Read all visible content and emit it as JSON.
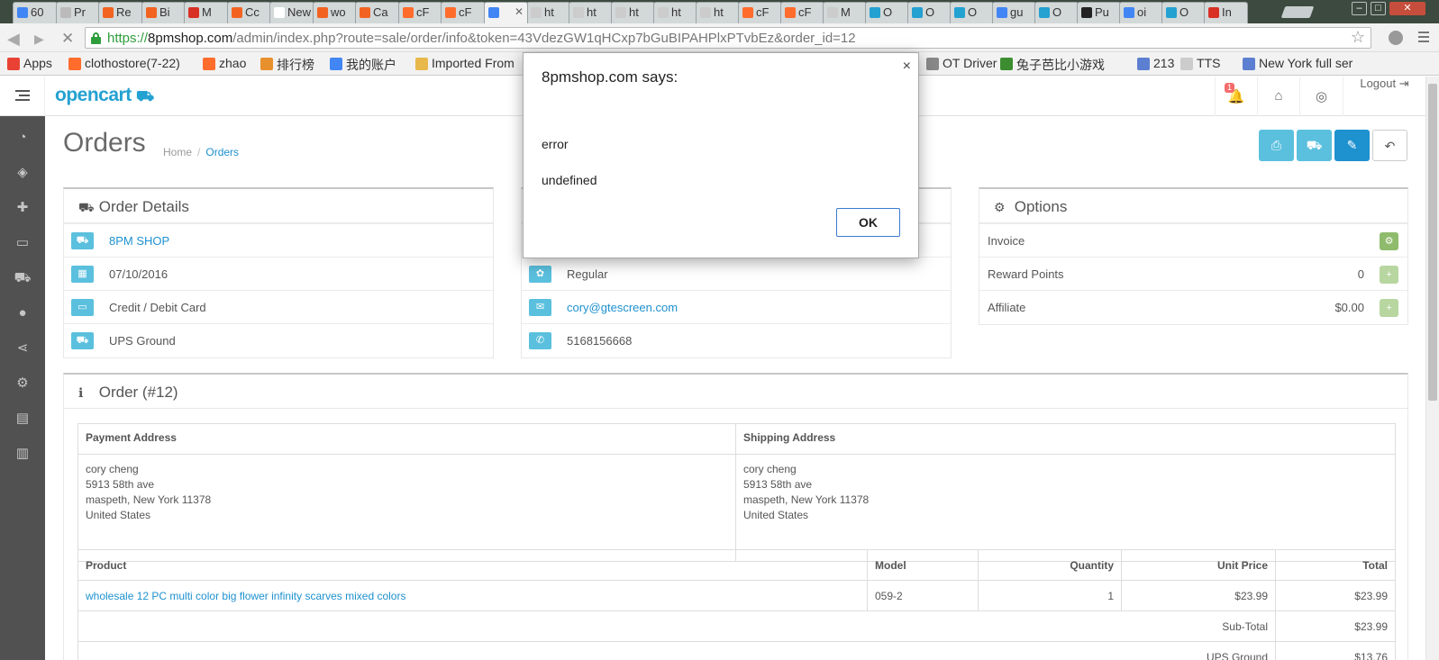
{
  "browser": {
    "tabs": [
      {
        "label": "60",
        "fav": "#4285f4"
      },
      {
        "label": "Pr",
        "fav": "#bbbbbb"
      },
      {
        "label": "Re",
        "fav": "#f26322"
      },
      {
        "label": "Bi",
        "fav": "#f26322"
      },
      {
        "label": "M",
        "fav": "#d93025"
      },
      {
        "label": "Cc",
        "fav": "#f26322"
      },
      {
        "label": "New",
        "fav": "#ffffff"
      },
      {
        "label": "wo",
        "fav": "#f26322"
      },
      {
        "label": "Ca",
        "fav": "#f26322"
      },
      {
        "label": "cF",
        "fav": "#ff6c2c"
      },
      {
        "label": "cF",
        "fav": "#ff6c2c"
      },
      {
        "label": "",
        "fav": "#4285f4"
      },
      {
        "label": "ht",
        "fav": "#cccccc"
      },
      {
        "label": "ht",
        "fav": "#cccccc"
      },
      {
        "label": "ht",
        "fav": "#cccccc"
      },
      {
        "label": "ht",
        "fav": "#cccccc"
      },
      {
        "label": "ht",
        "fav": "#cccccc"
      },
      {
        "label": "cF",
        "fav": "#ff6c2c"
      },
      {
        "label": "cF",
        "fav": "#ff6c2c"
      },
      {
        "label": "M",
        "fav": "#cccccc"
      },
      {
        "label": "O",
        "fav": "#23a1d1"
      },
      {
        "label": "O",
        "fav": "#23a1d1"
      },
      {
        "label": "O",
        "fav": "#23a1d1"
      },
      {
        "label": "gu",
        "fav": "#4285f4"
      },
      {
        "label": "O",
        "fav": "#23a1d1"
      },
      {
        "label": "Pu",
        "fav": "#222222"
      },
      {
        "label": "oi",
        "fav": "#4285f4"
      },
      {
        "label": "O",
        "fav": "#23a1d1"
      },
      {
        "label": "In",
        "fav": "#d93025"
      }
    ],
    "url": {
      "scheme": "https://",
      "host": "8pmshop.com",
      "path": "/admin/index.php?route=sale/order/info&token=43VdezGW1qHCxp7bGuBIPAHPlxPTvbEz&order_id=12"
    },
    "bookmarks": [
      {
        "label": "Apps",
        "color": "#e94235"
      },
      {
        "label": "clothostore(7-22)",
        "color": "#ff6c2c"
      },
      {
        "label": "zhao",
        "color": "#ff6c2c"
      },
      {
        "label": "排行榜",
        "color": "#e8902d"
      },
      {
        "label": "我的账户",
        "color": "#4285f4"
      },
      {
        "label": "Imported From",
        "color": "#e8b84a"
      },
      {
        "label": "OT Driver",
        "color": "#888888"
      },
      {
        "label": "兔子芭比小游戏",
        "color": "#3c8d2f"
      },
      {
        "label": "213",
        "color": "#5c7fd1"
      },
      {
        "label": "TTS",
        "color": "#cccccc"
      },
      {
        "label": "New York full ser",
        "color": "#5c7fd1"
      }
    ]
  },
  "header": {
    "logo": "opencart",
    "notifications_count": "1",
    "logout_label": "Logout"
  },
  "page": {
    "title": "Orders",
    "breadcrumb_home": "Home",
    "breadcrumb_current": "Orders"
  },
  "order_details": {
    "title": "Order Details",
    "store": "8PM SHOP",
    "date": "07/10/2016",
    "payment_method": "Credit / Debit Card",
    "shipping_method": "UPS Ground"
  },
  "customer": {
    "group": "Regular",
    "email": "cory@gtescreen.com",
    "phone": "5168156668"
  },
  "options": {
    "title": "Options",
    "invoice_label": "Invoice",
    "reward_label": "Reward Points",
    "reward_value": "0",
    "affiliate_label": "Affiliate",
    "affiliate_value": "$0.00"
  },
  "order": {
    "title": "Order (#12)",
    "payment_address_header": "Payment Address",
    "shipping_address_header": "Shipping Address",
    "payment_address": [
      "cory cheng",
      "5913 58th ave",
      "maspeth, New York 11378",
      "United States"
    ],
    "shipping_address": [
      "cory cheng",
      "5913 58th ave",
      "maspeth, New York 11378",
      "United States"
    ],
    "columns": [
      "Product",
      "Model",
      "Quantity",
      "Unit Price",
      "Total"
    ],
    "product": {
      "name": "wholesale 12 PC multi color big flower infinity scarves mixed colors",
      "model": "059-2",
      "quantity": "1",
      "unit_price": "$23.99",
      "total": "$23.99"
    },
    "subtotal_label": "Sub-Total",
    "subtotal_value": "$23.99",
    "shipping_label": "UPS Ground",
    "shipping_value": "$13.76"
  },
  "dialog": {
    "title": "8pmshop.com says:",
    "line1": "error",
    "line2": "undefined",
    "ok_label": "OK",
    "close_glyph": "×"
  }
}
